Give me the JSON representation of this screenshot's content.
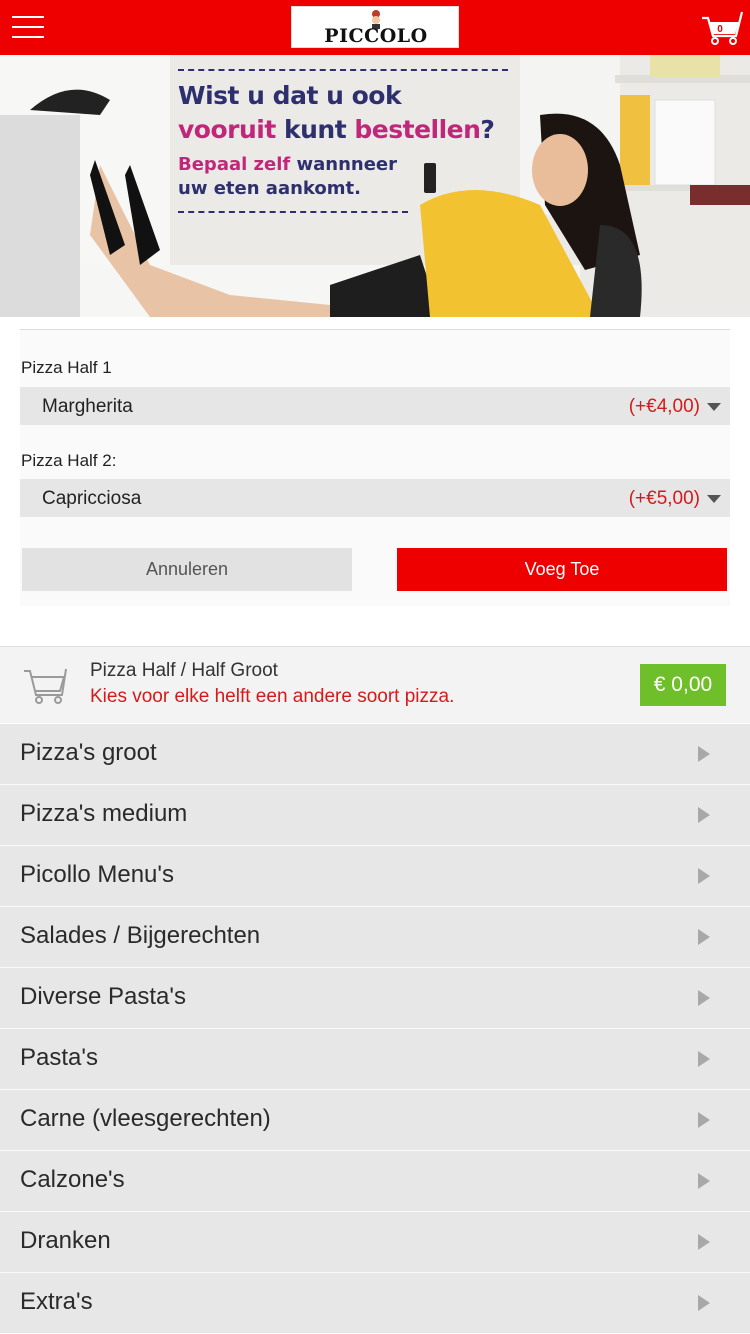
{
  "header": {
    "brand_name": "PICCOLO",
    "cart_count": "0",
    "brand_color": "#ee0000"
  },
  "banner": {
    "line1": "Wist u dat u ook",
    "line2_part1": "vooruit",
    "line2_part2": " kunt ",
    "line2_part3": "bestellen",
    "line2_part4": "?",
    "line3_part1": "Bepaal zelf",
    "line3_part2": " wannneer",
    "line4": "uw eten aankomt."
  },
  "options": {
    "half1": {
      "label": "Pizza Half 1",
      "value": "Margherita",
      "price": "(+€4,00)"
    },
    "half2": {
      "label": "Pizza Half 2:",
      "value": "Capricciosa",
      "price": "(+€5,00)"
    },
    "cancel_label": "Annuleren",
    "add_label": "Voeg Toe"
  },
  "product": {
    "title": "Pizza Half / Half Groot",
    "description": "Kies voor elke helft een andere soort pizza.",
    "price": "€ 0,00",
    "price_color": "#6fbf2a"
  },
  "categories": [
    "Pizza's groot",
    "Pizza's medium",
    "Picollo Menu's",
    "Salades / Bijgerechten",
    "Diverse Pasta's",
    "Pasta's",
    "Carne (vleesgerechten)",
    "Calzone's",
    "Dranken",
    "Extra's"
  ]
}
